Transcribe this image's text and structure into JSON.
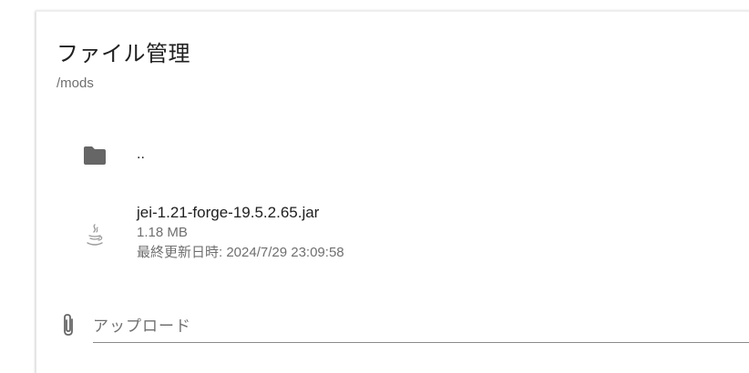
{
  "file_manager": {
    "title": "ファイル管理",
    "path": "/mods",
    "items": [
      {
        "type": "parent-folder",
        "icon": "folder-icon",
        "name": ".."
      },
      {
        "type": "file",
        "icon": "java-icon",
        "name": "jei-1.21-forge-19.5.2.65.jar",
        "size": "1.18 MB",
        "modified": "最終更新日時: 2024/7/29 23:09:58"
      }
    ],
    "upload": {
      "icon": "paperclip-icon",
      "placeholder": "アップロード"
    }
  },
  "colors": {
    "icon": "#666666",
    "text_primary": "#202020",
    "text_secondary": "#6f6f6f",
    "underline": "#8a8a8a"
  }
}
